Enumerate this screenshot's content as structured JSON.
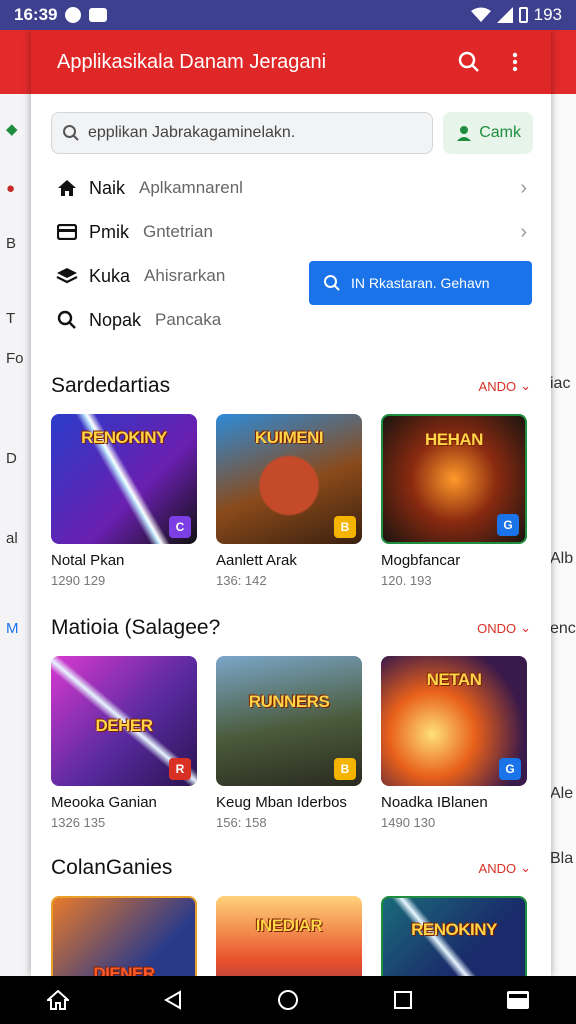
{
  "status": {
    "time": "16:39",
    "battery": "193"
  },
  "app": {
    "title": "Applikasikala Danam Jeragani"
  },
  "search": {
    "placeholder": "epplikan Jabrakagaminelakn.",
    "chip": "Camk"
  },
  "menu": [
    {
      "label": "Naik",
      "sub": "Aplkamnarenl",
      "icon": "home-icon"
    },
    {
      "label": "Pmik",
      "sub": "Gntetrian",
      "icon": "card-icon"
    },
    {
      "label": "Kuka",
      "sub": "Ahisrarkan",
      "icon": "layers-icon"
    },
    {
      "label": "Nopak",
      "sub": "Pancaka",
      "icon": "search-icon"
    }
  ],
  "blue_button": "IN Rkastaran. Gehavn",
  "sections": [
    {
      "title": "Sardedartias",
      "more": "ANDO",
      "items": [
        {
          "name": "Notal Pkan",
          "meta": "1290 129",
          "art": "RENOKINY",
          "badge_color": "#7b3fe4",
          "badge": "C"
        },
        {
          "name": "Aanlett Arak",
          "meta": "136: 142",
          "art": "KUIMENI",
          "badge_color": "#f4b400",
          "badge": "B"
        },
        {
          "name": "Mogbfancar",
          "meta": "120. 193",
          "art": "HEHAN",
          "badge_color": "#1a73e8",
          "badge": "G"
        }
      ]
    },
    {
      "title": "Matioia (Salagee?",
      "more": "ONDO",
      "items": [
        {
          "name": "Meooka Ganian",
          "meta": "1326 135",
          "art": "DEHER",
          "badge_color": "#d93025",
          "badge": "R"
        },
        {
          "name": "Keug Mban Iderbos",
          "meta": "156: 158",
          "art": "RUNNERS",
          "badge_color": "#f4b400",
          "badge": "B"
        },
        {
          "name": "Noadka IBlanen",
          "meta": "1490 130",
          "art": "NETAN",
          "badge_color": "#1a73e8",
          "badge": "G"
        }
      ]
    },
    {
      "title": "ColanGanies",
      "more": "ANDO",
      "items": [
        {
          "name": "",
          "meta": "",
          "art": "DIENER",
          "badge_color": "#d93025",
          "badge": ""
        },
        {
          "name": "",
          "meta": "",
          "art": "INEDIAR",
          "badge_color": "#f4b400",
          "badge": ""
        },
        {
          "name": "",
          "meta": "",
          "art": "RENOKINY",
          "badge_color": "#1a73e8",
          "badge": ""
        }
      ]
    }
  ],
  "colors": {
    "appbar": "#e02727",
    "accent": "#1a73e8",
    "more": "#d93025"
  }
}
